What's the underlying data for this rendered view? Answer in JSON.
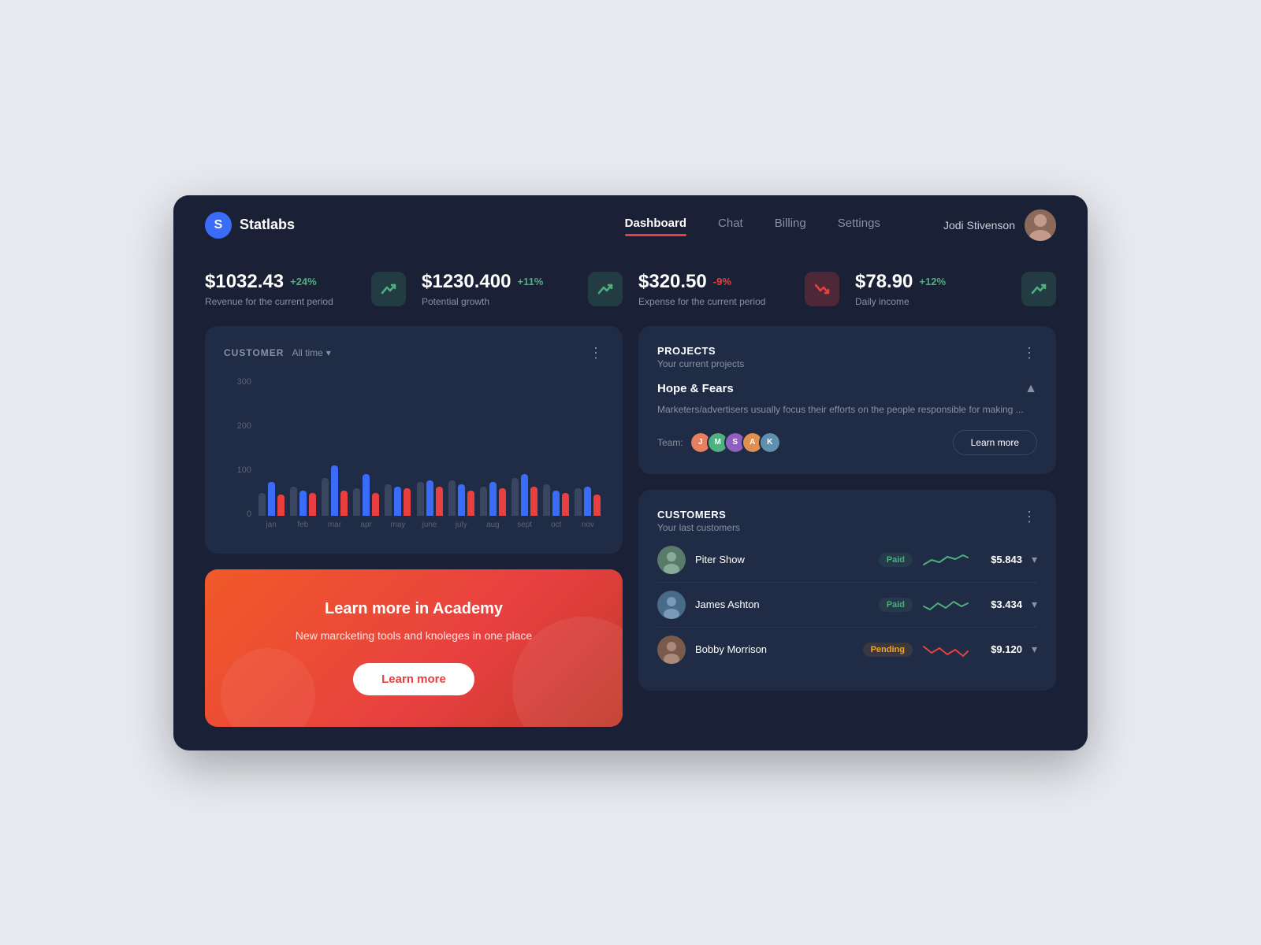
{
  "app": {
    "name": "Statlabs",
    "logo_letter": "S"
  },
  "nav": {
    "items": [
      {
        "label": "Dashboard",
        "active": true
      },
      {
        "label": "Chat",
        "active": false
      },
      {
        "label": "Billing",
        "active": false
      },
      {
        "label": "Settings",
        "active": false
      }
    ]
  },
  "user": {
    "name": "Jodi Stivenson"
  },
  "stats": [
    {
      "value": "$1032.43",
      "change": "+24%",
      "change_type": "pos",
      "label": "Revenue for the current period",
      "icon_type": "green"
    },
    {
      "value": "$1230.400",
      "change": "+11%",
      "change_type": "pos",
      "label": "Potential growth",
      "icon_type": "green"
    },
    {
      "value": "$320.50",
      "change": "-9%",
      "change_type": "neg",
      "label": "Expense for the current period",
      "icon_type": "red"
    },
    {
      "value": "$78.90",
      "change": "+12%",
      "change_type": "pos",
      "label": "Daily income",
      "icon_type": "green"
    }
  ],
  "chart": {
    "title": "CUSTOMER",
    "filter": "All time",
    "y_labels": [
      "300",
      "200",
      "100",
      "0"
    ],
    "months": [
      "jan",
      "feb",
      "mar",
      "apr",
      "may",
      "june",
      "july",
      "aug",
      "sept",
      "oct",
      "nov"
    ],
    "bars": [
      {
        "gray": 55,
        "blue": 80,
        "orange": 50
      },
      {
        "gray": 70,
        "blue": 60,
        "orange": 55
      },
      {
        "gray": 90,
        "blue": 120,
        "orange": 60
      },
      {
        "gray": 65,
        "blue": 100,
        "orange": 55
      },
      {
        "gray": 75,
        "blue": 70,
        "orange": 65
      },
      {
        "gray": 80,
        "blue": 85,
        "orange": 70
      },
      {
        "gray": 85,
        "blue": 75,
        "orange": 60
      },
      {
        "gray": 70,
        "blue": 80,
        "orange": 65
      },
      {
        "gray": 90,
        "blue": 100,
        "orange": 70
      },
      {
        "gray": 75,
        "blue": 60,
        "orange": 55
      },
      {
        "gray": 65,
        "blue": 70,
        "orange": 50
      }
    ]
  },
  "promo": {
    "title": "Learn more in Academy",
    "description": "New marcketing tools and knoleges in one place",
    "button_label": "Learn more"
  },
  "projects": {
    "title": "PROJECTS",
    "subtitle": "Your current projects",
    "items": [
      {
        "name": "Hope & Fears",
        "description": "Marketers/advertisers usually focus their efforts on the people responsible for making ...",
        "team_label": "Team:",
        "team_members": [
          "#e88",
          "#5b9",
          "#a5c",
          "#e98",
          "#7ab"
        ],
        "learn_more_label": "Learn more"
      }
    ]
  },
  "customers": {
    "title": "CUSTOMERS",
    "subtitle": "Your last customers",
    "items": [
      {
        "name": "Piter Show",
        "status": "Paid",
        "status_type": "paid",
        "amount": "$5.843",
        "avatar_color": "#5a7a6a"
      },
      {
        "name": "James Ashton",
        "status": "Paid",
        "status_type": "paid",
        "amount": "$3.434",
        "avatar_color": "#4a6a8a"
      },
      {
        "name": "Bobby Morrison",
        "status": "Pending",
        "status_type": "pending",
        "amount": "$9.120",
        "avatar_color": "#7a5a4a"
      }
    ]
  }
}
